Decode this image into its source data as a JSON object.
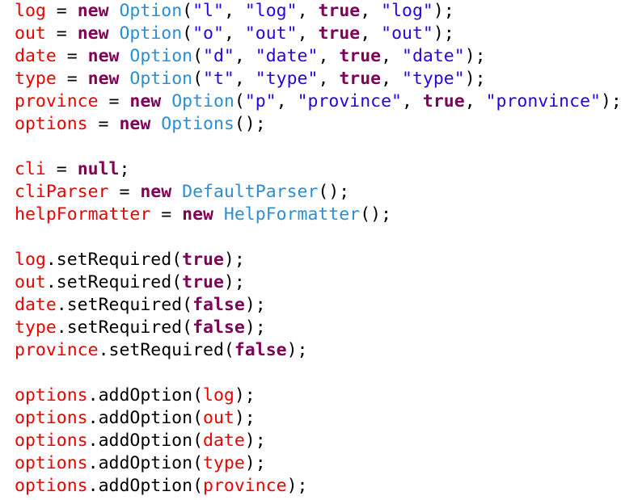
{
  "editor": {
    "background_color": "#ffffff",
    "language": "java",
    "font_size_px": 21.5,
    "line_height_px": 28,
    "colors": {
      "variable": "#ee0000",
      "keyword": "#7f0055",
      "type": "#2b8fd4",
      "string": "#2a00e6",
      "plain": "#000000"
    }
  },
  "lines": [
    {
      "index": 0,
      "text": "log = new Option(\"l\", \"log\", true, \"log\");",
      "tokens": [
        {
          "t": "log",
          "k": "var"
        },
        {
          "t": " = ",
          "k": "plain"
        },
        {
          "t": "new",
          "k": "keyword"
        },
        {
          "t": " ",
          "k": "plain"
        },
        {
          "t": "Option",
          "k": "type"
        },
        {
          "t": "(",
          "k": "punct"
        },
        {
          "t": "\"l\"",
          "k": "string"
        },
        {
          "t": ", ",
          "k": "punct"
        },
        {
          "t": "\"log\"",
          "k": "string"
        },
        {
          "t": ", ",
          "k": "punct"
        },
        {
          "t": "true",
          "k": "keyword"
        },
        {
          "t": ", ",
          "k": "punct"
        },
        {
          "t": "\"log\"",
          "k": "string"
        },
        {
          "t": ");",
          "k": "punct"
        }
      ]
    },
    {
      "index": 1,
      "text": "out = new Option(\"o\", \"out\", true, \"out\");",
      "tokens": [
        {
          "t": "out",
          "k": "var"
        },
        {
          "t": " = ",
          "k": "plain"
        },
        {
          "t": "new",
          "k": "keyword"
        },
        {
          "t": " ",
          "k": "plain"
        },
        {
          "t": "Option",
          "k": "type"
        },
        {
          "t": "(",
          "k": "punct"
        },
        {
          "t": "\"o\"",
          "k": "string"
        },
        {
          "t": ", ",
          "k": "punct"
        },
        {
          "t": "\"out\"",
          "k": "string"
        },
        {
          "t": ", ",
          "k": "punct"
        },
        {
          "t": "true",
          "k": "keyword"
        },
        {
          "t": ", ",
          "k": "punct"
        },
        {
          "t": "\"out\"",
          "k": "string"
        },
        {
          "t": ");",
          "k": "punct"
        }
      ]
    },
    {
      "index": 2,
      "text": "date = new Option(\"d\", \"date\", true, \"date\");",
      "tokens": [
        {
          "t": "date",
          "k": "var"
        },
        {
          "t": " = ",
          "k": "plain"
        },
        {
          "t": "new",
          "k": "keyword"
        },
        {
          "t": " ",
          "k": "plain"
        },
        {
          "t": "Option",
          "k": "type"
        },
        {
          "t": "(",
          "k": "punct"
        },
        {
          "t": "\"d\"",
          "k": "string"
        },
        {
          "t": ", ",
          "k": "punct"
        },
        {
          "t": "\"date\"",
          "k": "string"
        },
        {
          "t": ", ",
          "k": "punct"
        },
        {
          "t": "true",
          "k": "keyword"
        },
        {
          "t": ", ",
          "k": "punct"
        },
        {
          "t": "\"date\"",
          "k": "string"
        },
        {
          "t": ");",
          "k": "punct"
        }
      ]
    },
    {
      "index": 3,
      "text": "type = new Option(\"t\", \"type\", true, \"type\");",
      "tokens": [
        {
          "t": "type",
          "k": "var"
        },
        {
          "t": " = ",
          "k": "plain"
        },
        {
          "t": "new",
          "k": "keyword"
        },
        {
          "t": " ",
          "k": "plain"
        },
        {
          "t": "Option",
          "k": "type"
        },
        {
          "t": "(",
          "k": "punct"
        },
        {
          "t": "\"t\"",
          "k": "string"
        },
        {
          "t": ", ",
          "k": "punct"
        },
        {
          "t": "\"type\"",
          "k": "string"
        },
        {
          "t": ", ",
          "k": "punct"
        },
        {
          "t": "true",
          "k": "keyword"
        },
        {
          "t": ", ",
          "k": "punct"
        },
        {
          "t": "\"type\"",
          "k": "string"
        },
        {
          "t": ");",
          "k": "punct"
        }
      ]
    },
    {
      "index": 4,
      "text": "province = new Option(\"p\", \"province\", true, \"pronvince\");",
      "tokens": [
        {
          "t": "province",
          "k": "var"
        },
        {
          "t": " = ",
          "k": "plain"
        },
        {
          "t": "new",
          "k": "keyword"
        },
        {
          "t": " ",
          "k": "plain"
        },
        {
          "t": "Option",
          "k": "type"
        },
        {
          "t": "(",
          "k": "punct"
        },
        {
          "t": "\"p\"",
          "k": "string"
        },
        {
          "t": ", ",
          "k": "punct"
        },
        {
          "t": "\"province\"",
          "k": "string"
        },
        {
          "t": ", ",
          "k": "punct"
        },
        {
          "t": "true",
          "k": "keyword"
        },
        {
          "t": ", ",
          "k": "punct"
        },
        {
          "t": "\"pronvince\"",
          "k": "string"
        },
        {
          "t": ");",
          "k": "punct"
        }
      ]
    },
    {
      "index": 5,
      "text": "options = new Options();",
      "tokens": [
        {
          "t": "options",
          "k": "var"
        },
        {
          "t": " = ",
          "k": "plain"
        },
        {
          "t": "new",
          "k": "keyword"
        },
        {
          "t": " ",
          "k": "plain"
        },
        {
          "t": "Options",
          "k": "type"
        },
        {
          "t": "();",
          "k": "punct"
        }
      ]
    },
    {
      "index": 6,
      "text": "",
      "tokens": []
    },
    {
      "index": 7,
      "text": "cli = null;",
      "tokens": [
        {
          "t": "cli",
          "k": "var"
        },
        {
          "t": " = ",
          "k": "plain"
        },
        {
          "t": "null",
          "k": "keyword"
        },
        {
          "t": ";",
          "k": "punct"
        }
      ]
    },
    {
      "index": 8,
      "text": "cliParser = new DefaultParser();",
      "tokens": [
        {
          "t": "cliParser",
          "k": "var"
        },
        {
          "t": " = ",
          "k": "plain"
        },
        {
          "t": "new",
          "k": "keyword"
        },
        {
          "t": " ",
          "k": "plain"
        },
        {
          "t": "DefaultParser",
          "k": "type"
        },
        {
          "t": "();",
          "k": "punct"
        }
      ]
    },
    {
      "index": 9,
      "text": "helpFormatter = new HelpFormatter();",
      "tokens": [
        {
          "t": "helpFormatter",
          "k": "var"
        },
        {
          "t": " = ",
          "k": "plain"
        },
        {
          "t": "new",
          "k": "keyword"
        },
        {
          "t": " ",
          "k": "plain"
        },
        {
          "t": "HelpFormatter",
          "k": "type"
        },
        {
          "t": "();",
          "k": "punct"
        }
      ]
    },
    {
      "index": 10,
      "text": "",
      "tokens": []
    },
    {
      "index": 11,
      "text": "log.setRequired(true);",
      "tokens": [
        {
          "t": "log",
          "k": "var"
        },
        {
          "t": ".",
          "k": "punct"
        },
        {
          "t": "setRequired",
          "k": "method"
        },
        {
          "t": "(",
          "k": "punct"
        },
        {
          "t": "true",
          "k": "keyword"
        },
        {
          "t": ");",
          "k": "punct"
        }
      ]
    },
    {
      "index": 12,
      "text": "out.setRequired(true);",
      "tokens": [
        {
          "t": "out",
          "k": "var"
        },
        {
          "t": ".",
          "k": "punct"
        },
        {
          "t": "setRequired",
          "k": "method"
        },
        {
          "t": "(",
          "k": "punct"
        },
        {
          "t": "true",
          "k": "keyword"
        },
        {
          "t": ");",
          "k": "punct"
        }
      ]
    },
    {
      "index": 13,
      "text": "date.setRequired(false);",
      "tokens": [
        {
          "t": "date",
          "k": "var"
        },
        {
          "t": ".",
          "k": "punct"
        },
        {
          "t": "setRequired",
          "k": "method"
        },
        {
          "t": "(",
          "k": "punct"
        },
        {
          "t": "false",
          "k": "keyword"
        },
        {
          "t": ");",
          "k": "punct"
        }
      ]
    },
    {
      "index": 14,
      "text": "type.setRequired(false);",
      "tokens": [
        {
          "t": "type",
          "k": "var"
        },
        {
          "t": ".",
          "k": "punct"
        },
        {
          "t": "setRequired",
          "k": "method"
        },
        {
          "t": "(",
          "k": "punct"
        },
        {
          "t": "false",
          "k": "keyword"
        },
        {
          "t": ");",
          "k": "punct"
        }
      ]
    },
    {
      "index": 15,
      "text": "province.setRequired(false);",
      "tokens": [
        {
          "t": "province",
          "k": "var"
        },
        {
          "t": ".",
          "k": "punct"
        },
        {
          "t": "setRequired",
          "k": "method"
        },
        {
          "t": "(",
          "k": "punct"
        },
        {
          "t": "false",
          "k": "keyword"
        },
        {
          "t": ");",
          "k": "punct"
        }
      ]
    },
    {
      "index": 16,
      "text": "",
      "tokens": []
    },
    {
      "index": 17,
      "text": "options.addOption(log);",
      "tokens": [
        {
          "t": "options",
          "k": "var"
        },
        {
          "t": ".",
          "k": "punct"
        },
        {
          "t": "addOption",
          "k": "method"
        },
        {
          "t": "(",
          "k": "punct"
        },
        {
          "t": "log",
          "k": "var"
        },
        {
          "t": ");",
          "k": "punct"
        }
      ]
    },
    {
      "index": 18,
      "text": "options.addOption(out);",
      "tokens": [
        {
          "t": "options",
          "k": "var"
        },
        {
          "t": ".",
          "k": "punct"
        },
        {
          "t": "addOption",
          "k": "method"
        },
        {
          "t": "(",
          "k": "punct"
        },
        {
          "t": "out",
          "k": "var"
        },
        {
          "t": ");",
          "k": "punct"
        }
      ]
    },
    {
      "index": 19,
      "text": "options.addOption(date);",
      "tokens": [
        {
          "t": "options",
          "k": "var"
        },
        {
          "t": ".",
          "k": "punct"
        },
        {
          "t": "addOption",
          "k": "method"
        },
        {
          "t": "(",
          "k": "punct"
        },
        {
          "t": "date",
          "k": "var"
        },
        {
          "t": ");",
          "k": "punct"
        }
      ]
    },
    {
      "index": 20,
      "text": "options.addOption(type);",
      "tokens": [
        {
          "t": "options",
          "k": "var"
        },
        {
          "t": ".",
          "k": "punct"
        },
        {
          "t": "addOption",
          "k": "method"
        },
        {
          "t": "(",
          "k": "punct"
        },
        {
          "t": "type",
          "k": "var"
        },
        {
          "t": ");",
          "k": "punct"
        }
      ]
    },
    {
      "index": 21,
      "text": "options.addOption(province);",
      "tokens": [
        {
          "t": "options",
          "k": "var"
        },
        {
          "t": ".",
          "k": "punct"
        },
        {
          "t": "addOption",
          "k": "method"
        },
        {
          "t": "(",
          "k": "punct"
        },
        {
          "t": "province",
          "k": "var"
        },
        {
          "t": ");",
          "k": "punct"
        }
      ]
    }
  ]
}
